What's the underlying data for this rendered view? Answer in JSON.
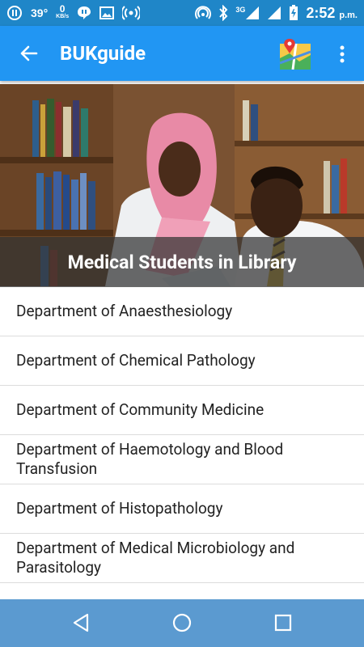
{
  "status_bar": {
    "temperature": "39°",
    "net_speed_value": "0",
    "net_speed_unit": "KB/s",
    "network_type": "3G",
    "time": "2:52",
    "time_suffix": "p.m."
  },
  "app_bar": {
    "title": "BUKguide"
  },
  "hero": {
    "caption": "Medical Students in Library"
  },
  "departments": [
    "Department of Anaesthesiology",
    "Department of Chemical Pathology",
    "Department of Community Medicine",
    "Department of Haemotology and Blood Transfusion",
    "Department of Histopathology",
    "Department of Medical Microbiology and Parasitology"
  ],
  "colors": {
    "status_bar": "#1f86c8",
    "app_bar": "#2196f3",
    "nav_bar": "#5b9ad0"
  }
}
